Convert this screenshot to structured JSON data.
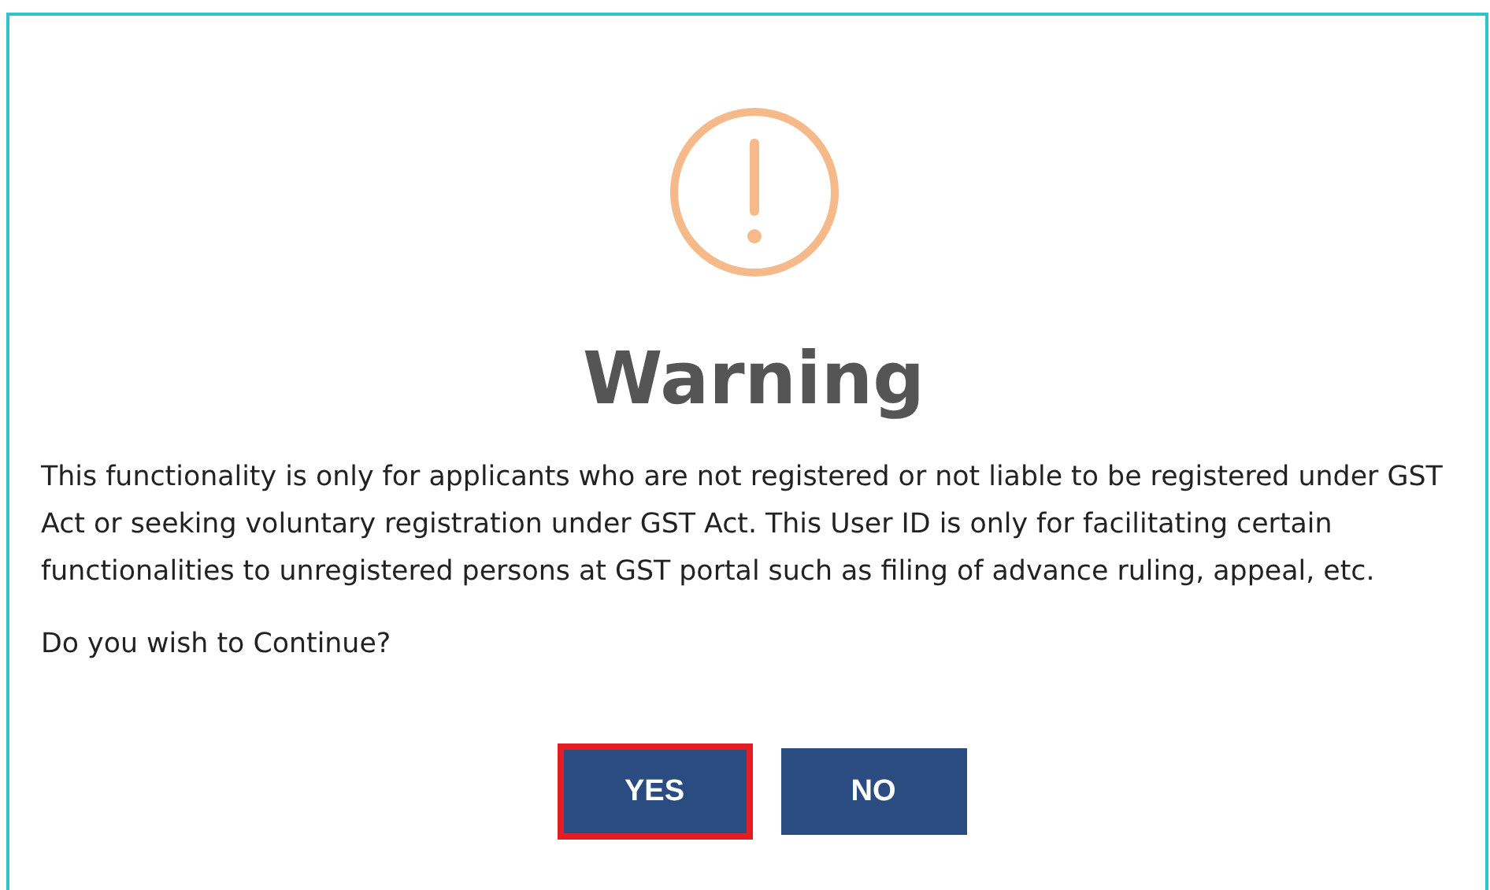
{
  "dialog": {
    "title": "Warning",
    "message": "This functionality is only for applicants who are not registered or not liable to be registered under GST Act or seeking voluntary registration under GST Act. This User ID is only for facilitating certain functionalities to unregistered persons at GST portal such as filing of advance ruling, appeal, etc.",
    "question": "Do you wish to Continue?",
    "buttons": [
      {
        "label": "YES",
        "highlighted": true
      },
      {
        "label": "NO",
        "highlighted": false
      }
    ]
  }
}
